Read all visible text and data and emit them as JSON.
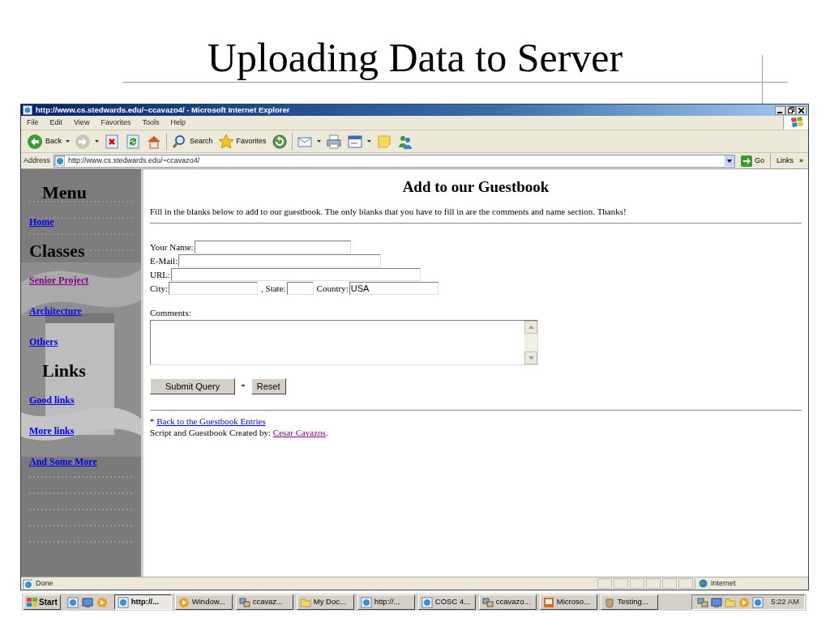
{
  "slide": {
    "title": "Uploading Data to Server"
  },
  "window": {
    "title": "http://www.cs.stedwards.edu/~ccavazo4/ - Microsoft Internet Explorer"
  },
  "menu": [
    "File",
    "Edit",
    "View",
    "Favorites",
    "Tools",
    "Help"
  ],
  "toolbar": [
    {
      "kind": "back",
      "label": "Back",
      "dropdown": true
    },
    {
      "kind": "forward",
      "dropdown": true
    },
    {
      "kind": "stop",
      "dropdown": false
    },
    {
      "kind": "refresh",
      "dropdown": false
    },
    {
      "kind": "home",
      "dropdown": false
    },
    {
      "kind": "search",
      "label": "Search",
      "dropdown": false
    },
    {
      "kind": "favorites",
      "label": "Favorites",
      "dropdown": false
    },
    {
      "kind": "media",
      "dropdown": false
    },
    {
      "kind": "mail",
      "dropdown": true
    },
    {
      "kind": "print",
      "dropdown": false
    },
    {
      "kind": "edit",
      "dropdown": true
    },
    {
      "kind": "note",
      "dropdown": false
    },
    {
      "kind": "messenger",
      "dropdown": false
    }
  ],
  "address": {
    "label": "Address",
    "value": "http://www.cs.stedwards.edu/~ccavazo4/",
    "go": "Go",
    "links": "Links",
    "more": "»"
  },
  "sidebar": [
    {
      "kind": "heading",
      "text": "Menu"
    },
    {
      "kind": "link",
      "text": "Home",
      "visited": false
    },
    {
      "kind": "heading",
      "text": "Classes"
    },
    {
      "kind": "link",
      "text": "Senior  Project",
      "visited": true
    },
    {
      "kind": "link",
      "text": "Architecture",
      "visited": false
    },
    {
      "kind": "link",
      "text": "Others",
      "visited": false
    },
    {
      "kind": "heading",
      "text": "Links"
    },
    {
      "kind": "link",
      "text": "Good links",
      "visited": false
    },
    {
      "kind": "link",
      "text": "More links",
      "visited": false
    },
    {
      "kind": "link",
      "text": "And Some More",
      "visited": false
    }
  ],
  "page": {
    "heading": "Add to our Guestbook",
    "intro": "Fill in the blanks below to add to our guestbook. The only blanks that you have to fill in are the comments and name section. Thanks!",
    "form_rows": [
      [
        {
          "kind": "label",
          "text": "Your Name:"
        },
        {
          "kind": "field"
        }
      ],
      [
        {
          "kind": "label",
          "text": "E-Mail:"
        },
        {
          "kind": "field"
        }
      ],
      [
        {
          "kind": "label",
          "text": "URL:"
        },
        {
          "kind": "field"
        }
      ],
      [
        {
          "kind": "label",
          "text": "City:"
        },
        {
          "kind": "field"
        },
        {
          "kind": "label",
          "text": ", State:"
        },
        {
          "kind": "field"
        },
        {
          "kind": "label",
          "text": "Country:"
        },
        {
          "kind": "field",
          "value": "USA"
        }
      ]
    ],
    "comments_label": "Comments:",
    "submit": "Submit Query",
    "separator": "*",
    "reset": "Reset",
    "back_mark": "*",
    "back_link": {
      "text": "Back to the Guestbook Entries",
      "visited": false
    },
    "credit": "Script and Guestbook Created by: ",
    "credit_link": {
      "text": "Cesar Cavazos",
      "visited": true
    },
    "credit_end": "."
  },
  "status_bar": {
    "text": "Done",
    "zone": "Internet"
  },
  "taskbar": {
    "start": "Start",
    "quick_launch": [
      {
        "kind": "ie"
      },
      {
        "kind": "desktop"
      },
      {
        "kind": "media"
      }
    ],
    "tasks": [
      {
        "label": "http://...",
        "kind": "ie",
        "selected": true
      },
      {
        "label": "Window...",
        "kind": "media",
        "selected": false
      },
      {
        "label": "ccavaz...",
        "kind": "net",
        "selected": false
      },
      {
        "label": "My Doc...",
        "kind": "folder",
        "selected": false
      },
      {
        "label": "http://...",
        "kind": "ie",
        "selected": false
      },
      {
        "label": "COSC 4...",
        "kind": "ie",
        "selected": false
      },
      {
        "label": "ccavazo...",
        "kind": "net",
        "selected": false
      },
      {
        "label": "Microso...",
        "kind": "ppt",
        "selected": false
      },
      {
        "label": "Testing...",
        "kind": "cup",
        "selected": false
      }
    ],
    "clock": "5:22 AM"
  }
}
